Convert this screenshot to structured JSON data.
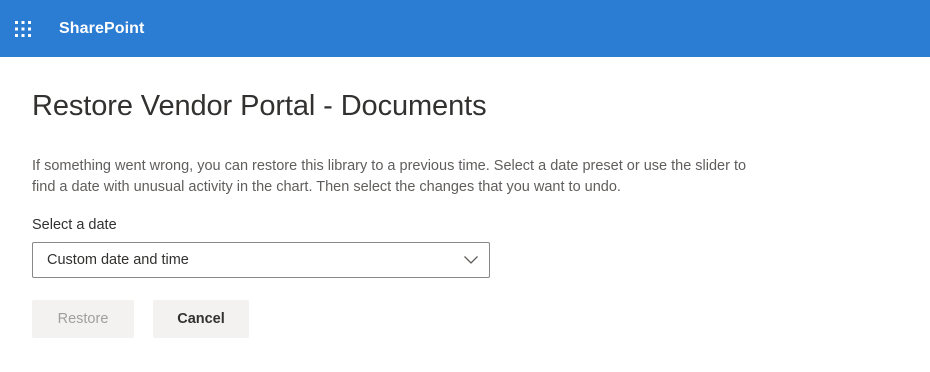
{
  "header": {
    "app_launcher_icon": "waffle-icon",
    "brand": "SharePoint",
    "background_color": "#2b7cd3"
  },
  "main": {
    "title": "Restore Vendor Portal - Documents",
    "description": "If something went wrong, you can restore this library to a previous time. Select a date preset or use the slider to find a date with unusual activity in the chart. Then select the changes that you want to undo.",
    "date_field": {
      "label": "Select a date",
      "selected_value": "Custom date and time",
      "chevron_icon": "chevron-down-icon"
    },
    "buttons": {
      "restore_label": "Restore",
      "restore_disabled": true,
      "cancel_label": "Cancel"
    }
  }
}
